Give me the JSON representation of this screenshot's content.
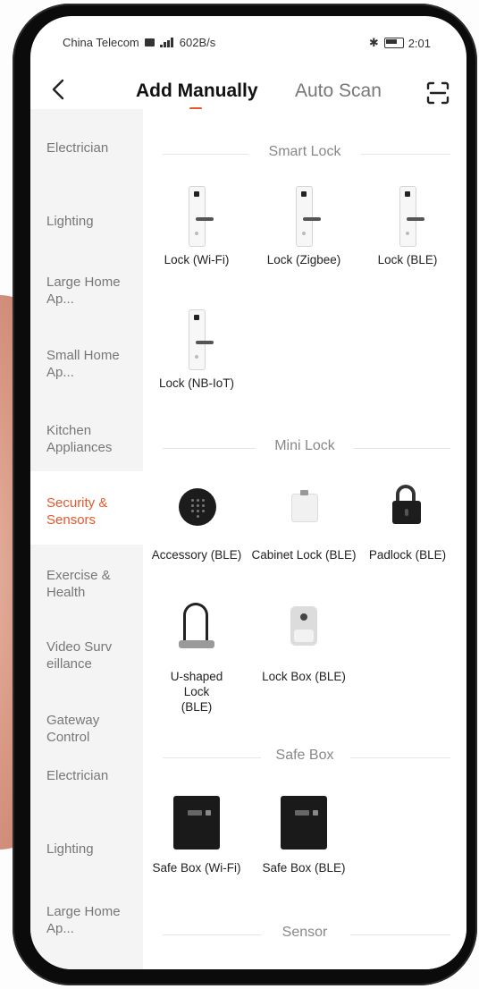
{
  "status_bar": {
    "carrier": "China Telecom",
    "net_speed": "602B/s",
    "battery": "80",
    "time": "2:01"
  },
  "header": {
    "tab_active": "Add Manually",
    "tab_inactive": "Auto Scan"
  },
  "sidebar": {
    "items": [
      {
        "label": "Electrician"
      },
      {
        "label": "Lighting"
      },
      {
        "label": "Large Home Ap..."
      },
      {
        "label": "Small Home Ap..."
      },
      {
        "label": "Kitchen Appliances"
      },
      {
        "label": "Security & Sensors"
      },
      {
        "label": "Exercise & Health"
      },
      {
        "label": "Video Surv eillance"
      },
      {
        "label": "Gateway Control"
      },
      {
        "label": "Electrician"
      },
      {
        "label": "Lighting"
      },
      {
        "label": "Large Home Ap..."
      }
    ],
    "active_index": 5
  },
  "sections": [
    {
      "title": "Smart Lock",
      "devices": [
        {
          "label": "Lock (Wi-Fi)",
          "icon": "smart-lock-icon"
        },
        {
          "label": "Lock (Zigbee)",
          "icon": "smart-lock-icon"
        },
        {
          "label": "Lock (BLE)",
          "icon": "smart-lock-icon"
        },
        {
          "label": "Lock (NB-IoT)",
          "icon": "smart-lock-icon"
        }
      ]
    },
    {
      "title": "Mini Lock",
      "devices": [
        {
          "label": "Accessory (BLE)",
          "icon": "keypad-icon"
        },
        {
          "label": "Cabinet Lock (BLE)",
          "icon": "cabinet-lock-icon"
        },
        {
          "label": "Padlock (BLE)",
          "icon": "padlock-icon"
        },
        {
          "label": "U-shaped Lock (BLE)",
          "icon": "u-lock-icon"
        },
        {
          "label": "Lock Box (BLE)",
          "icon": "lock-box-icon"
        }
      ]
    },
    {
      "title": "Safe Box",
      "devices": [
        {
          "label": "Safe Box (Wi-Fi)",
          "icon": "safe-box-icon"
        },
        {
          "label": "Safe Box (BLE)",
          "icon": "safe-box-icon"
        }
      ]
    },
    {
      "title": "Sensor",
      "devices": []
    }
  ],
  "colors": {
    "accent": "#e8572a",
    "sidebar_bg": "#f4f4f4"
  }
}
